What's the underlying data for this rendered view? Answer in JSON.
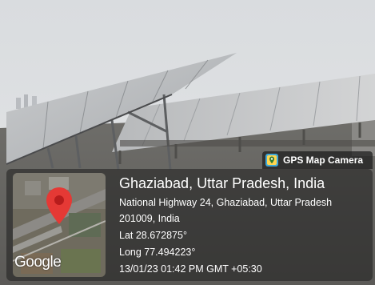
{
  "overlay": {
    "app_badge": "GPS Map Camera",
    "location_title": "Ghaziabad, Uttar Pradesh, India",
    "address_line1": "National Highway 24, Ghaziabad, Uttar Pradesh",
    "address_line2": "201009, India",
    "latitude": "Lat 28.672875°",
    "longitude": "Long 77.494223°",
    "datetime": "13/01/23 01:42 PM GMT +05:30",
    "map_brand": "Google",
    "icons": [
      "gps-map-camera-app-icon",
      "map-pin-icon"
    ],
    "colors": {
      "pin": "#e53935",
      "panel": "#1e1e1e",
      "text": "#ffffff"
    }
  }
}
